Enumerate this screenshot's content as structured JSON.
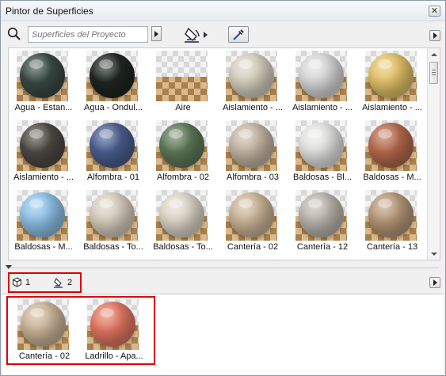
{
  "window": {
    "title": "Pintor de Superficies"
  },
  "toolbar": {
    "search_placeholder": "Superficies del Proyecto"
  },
  "materials": [
    {
      "label": "Agua - Estan...",
      "color": "#3b4b45"
    },
    {
      "label": "Agua - Ondul...",
      "color": "#1f2622"
    },
    {
      "label": "Aire",
      "color": "transparent"
    },
    {
      "label": "Aislamiento - ...",
      "color": "#d8d2c2"
    },
    {
      "label": "Aislamiento - ...",
      "color": "#dbdbdb"
    },
    {
      "label": "Aislamiento - ...",
      "color": "#e5c46a"
    },
    {
      "label": "Aislamiento - ...",
      "color": "#4e4a44"
    },
    {
      "label": "Alfombra - 01",
      "color": "#4b5f8f"
    },
    {
      "label": "Alfombra - 02",
      "color": "#5f7a5a"
    },
    {
      "label": "Alfombra - 03",
      "color": "#c7b8a7"
    },
    {
      "label": "Baldosas - Bl...",
      "color": "#e6e6e4"
    },
    {
      "label": "Baldosas - M...",
      "color": "#b86b4e"
    },
    {
      "label": "Baldosas - M...",
      "color": "#8fc3e8"
    },
    {
      "label": "Baldosas - To...",
      "color": "#d9d0c0"
    },
    {
      "label": "Baldosas - To...",
      "color": "#e0d8cb"
    },
    {
      "label": "Cantería - 02",
      "color": "#cdb79a"
    },
    {
      "label": "Cantería - 12",
      "color": "#bdb8b0"
    },
    {
      "label": "Cantería - 13",
      "color": "#b89a7a"
    }
  ],
  "usage": {
    "objects_count": "1",
    "surfaces_count": "2"
  },
  "selected_surfaces": [
    {
      "label": "Cantería - 02",
      "color": "#cdb79a"
    },
    {
      "label": "Ladrillo - Apa...",
      "color": "#e47864"
    }
  ]
}
